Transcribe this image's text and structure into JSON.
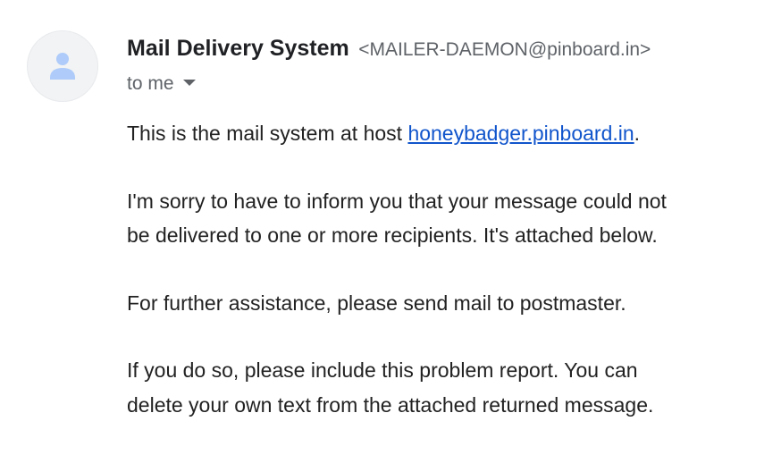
{
  "email": {
    "sender": {
      "name": "Mail Delivery System",
      "address": "<MAILER-DAEMON@pinboard.in>",
      "avatar_icon": "person-icon"
    },
    "recipient": {
      "label": "to me",
      "details_icon": "caret-down-icon"
    },
    "body": {
      "p1_prefix": "This is the mail system at host ",
      "p1_link": "honeybadger.pinboard.in",
      "p1_suffix": ".",
      "p2_line1": "I'm sorry to have to inform you that your message could not",
      "p2_line2": "be delivered to one or more recipients. It's attached below.",
      "p3": "For further assistance, please send mail to postmaster.",
      "p4_line1": "If you do so, please include this problem report. You can",
      "p4_line2": "delete your own text from the attached returned message."
    }
  },
  "colors": {
    "link": "#1155cc",
    "avatar_bg": "#f1f3f4",
    "avatar_icon": "#aecbfa",
    "secondary_text": "#5f6368"
  }
}
